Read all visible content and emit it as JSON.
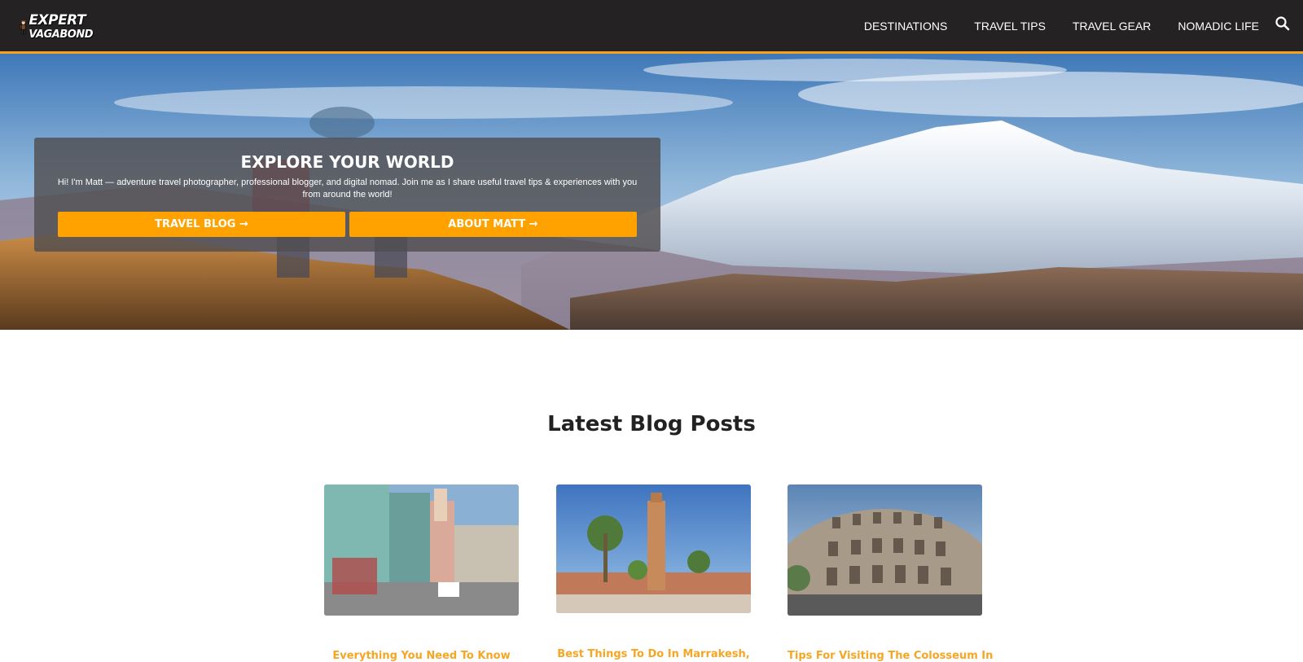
{
  "header": {
    "logo_line1": "EXPERT",
    "logo_line2": "VAGABOND",
    "nav": [
      "DESTINATIONS",
      "TRAVEL TIPS",
      "TRAVEL GEAR",
      "NOMADIC LIFE"
    ],
    "search_icon": "search-icon"
  },
  "hero": {
    "title": "EXPLORE YOUR WORLD",
    "text": "Hi! I'm Matt — adventure travel photographer, professional blogger, and digital nomad. Join me as I share useful travel tips & experiences with you from around the world!",
    "btn_blog": "TRAVEL BLOG →",
    "btn_about": "ABOUT MATT →"
  },
  "latest": {
    "title": "Latest Blog Posts",
    "posts": [
      {
        "title": "Everything You Need To Know"
      },
      {
        "title": "Best Things To Do In Marrakesh,"
      },
      {
        "title": "Tips For Visiting The Colosseum In"
      }
    ]
  },
  "colors": {
    "header_bg": "#242223",
    "accent": "#ffa200",
    "title_link": "#f5a623"
  }
}
